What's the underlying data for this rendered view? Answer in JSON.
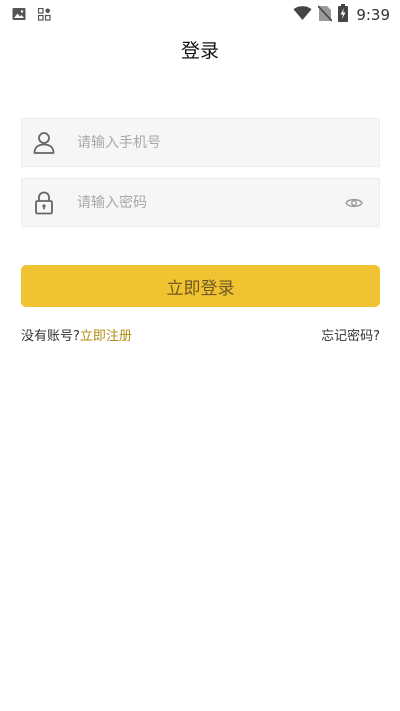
{
  "status_bar": {
    "time": "9:39",
    "icons": [
      "image-icon",
      "apps-icon",
      "wifi-icon",
      "no-sim-icon",
      "battery-charging-icon"
    ]
  },
  "header": {
    "title": "登录"
  },
  "phone_field": {
    "icon": "user-icon",
    "placeholder": "请输入手机号",
    "value": ""
  },
  "password_field": {
    "icon": "lock-icon",
    "placeholder": "请输入密码",
    "value": "",
    "toggle_icon": "eye-icon"
  },
  "login_button": {
    "label": "立即登录"
  },
  "links": {
    "no_account_prompt": "没有账号?",
    "register_label": "立即注册",
    "forgot_password_label": "忘记密码?"
  },
  "colors": {
    "accent": "#f1c232",
    "link": "#b08a10",
    "field_bg": "#f6f6f6"
  }
}
